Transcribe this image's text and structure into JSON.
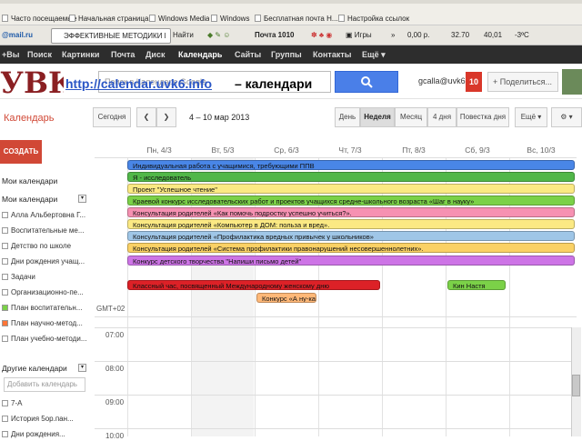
{
  "bookmarks": [
    "Часто посещаемые",
    "Начальная страница",
    "Windows Media",
    "Windows",
    "Бесплатная почта H...",
    "Настройка ссылок"
  ],
  "toolbar": {
    "mailru": "@mail.ru",
    "tab_title": "ЭФФЕКТИВНЫЕ МЕТОДИКИ И",
    "find": "Найти",
    "mail": "Почта 1010",
    "games": "Игры",
    "money": "0,00 р.",
    "usd": "32.70",
    "eur": "40,01",
    "weather": "-3ºС"
  },
  "gbar": [
    "+Вы",
    "Поиск",
    "Картинки",
    "Почта",
    "Диск",
    "Календарь",
    "Сайты",
    "Группы",
    "Контакты",
    "Ещё ▾"
  ],
  "header": {
    "logo": "УВК6",
    "url": "http://calendar.uvk6.info",
    "suffix": "– календари",
    "search_placeholder": "Поиск в Календаре Google",
    "user": "gcalla@uvk6...",
    "notif": "10",
    "share": "+ Поделиться..."
  },
  "cal_toolbar": {
    "title": "Календарь",
    "today": "Сегодня",
    "range": "4 – 10 мар 2013",
    "views": [
      "День",
      "Неделя",
      "Месяц",
      "4 дня",
      "Повестка дня"
    ],
    "more": "Ещё ▾"
  },
  "sidebar": {
    "create": "СОЗДАТЬ",
    "my_cals_link": "Мои календари",
    "my_cals_header": "Мои календари",
    "my_cals": [
      {
        "name": "Алла Альбертовна Г...",
        "color": "#ffffff"
      },
      {
        "name": "Воспитательные ме...",
        "color": "#ffffff"
      },
      {
        "name": "Детство по школе",
        "color": "#ffffff"
      },
      {
        "name": "Дни рождения учащ...",
        "color": "#ffffff"
      },
      {
        "name": "Задачи",
        "color": "#ffffff"
      },
      {
        "name": "Организационно-пе...",
        "color": "#ffffff"
      },
      {
        "name": "План воспитательн...",
        "color": "#7bd148"
      },
      {
        "name": "План научно-метод...",
        "color": "#ff7537"
      },
      {
        "name": "План учебно-методи...",
        "color": "#ffffff"
      }
    ],
    "other_header": "Другие календари",
    "add_placeholder": "Добавить календарь",
    "other_cals": [
      "7-А",
      "История 5ор.пан...",
      "Дни рождения..."
    ]
  },
  "days": [
    "Пн, 4/3",
    "Вт, 5/3",
    "Ср, 6/3",
    "Чт, 7/3",
    "Пт, 8/3",
    "Сб, 9/3",
    "Вс, 10/3"
  ],
  "gmt": "GMT+02",
  "times": [
    "07:00",
    "08:00",
    "09:00",
    "10:00"
  ],
  "events": [
    {
      "text": "Индивидуальная работа с учащимися, требующими ППВ",
      "color": "#4986e7"
    },
    {
      "text": "Я - исследователь",
      "color": "#51b749"
    },
    {
      "text": "Проект \"Успешное чтение\"",
      "color": "#fbe983"
    },
    {
      "text": "Краевой конкурс исследовательских работ и проектов учащихся средне-школьного возраста «Шаг в науку»",
      "color": "#7bd148"
    },
    {
      "text": "Консультация родителей «Как помочь подростку успешно учиться?».",
      "color": "#f691b2"
    },
    {
      "text": "Консультация родителей «Компьютер в ДОМ: польза и вред».",
      "color": "#fbe983"
    },
    {
      "text": "Консультация родителей «Профилактика вредных привычек у школьников»",
      "color": "#9fc6e7"
    },
    {
      "text": "Консультация родителей «Система профилактики правонарушений несовершеннолетних».",
      "color": "#fad165"
    },
    {
      "text": "Конкурс детского творчества \"Напиши письмо детей\"",
      "color": "#cd74e6"
    },
    {
      "text": "Классный час, посвященный Международному женскому дню",
      "color": "#dc2127"
    },
    {
      "text": "Конкурс «А ну-ка!»",
      "color": "#ffb878"
    },
    {
      "text": "Кин Настя",
      "color": "#7bd148"
    }
  ]
}
